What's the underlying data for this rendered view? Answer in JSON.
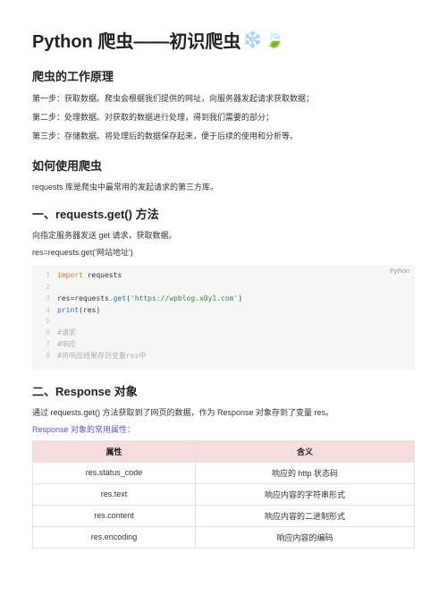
{
  "title": "Python 爬虫——初识爬虫",
  "emoji1": "❄️",
  "emoji2": "🍃",
  "sections": {
    "principle": {
      "heading": "爬虫的工作原理",
      "lines": [
        "第一步：获取数据。爬虫会根据我们提供的网址，向服务器发起请求获取数据；",
        "第二步：处理数据。对获取的数据进行处理，得到我们需要的部分；",
        "第三步：存储数据。将处理后的数据保存起来，便于后续的使用和分析等。"
      ]
    },
    "howto": {
      "heading": "如何使用爬虫",
      "desc": "requests 库是爬虫中最常用的发起请求的第三方库。"
    },
    "get": {
      "heading": "一、requests.get() 方法",
      "desc": "向指定服务器发送 get 请求，获取数据。",
      "snippet": "res=requests.get('网站地址')"
    },
    "code": {
      "lang": "Python",
      "lines": [
        {
          "n": "1",
          "kw": "import",
          "rest": " requests"
        },
        {
          "n": "2",
          "blank": true
        },
        {
          "n": "3",
          "assign_l": "res",
          "assign_r_mod": "requests",
          "assign_r_fn": ".get",
          "str": "'https://wpblog.x0y1.com'"
        },
        {
          "n": "4",
          "fn": "print",
          "arg": "res"
        },
        {
          "n": "5",
          "blank": true
        },
        {
          "n": "6",
          "cm": "#请求"
        },
        {
          "n": "7",
          "cm": "#响应"
        },
        {
          "n": "8",
          "cm": "#将响应结果存到变量res中"
        }
      ]
    },
    "response": {
      "heading": "二、Response 对象",
      "desc": "通过 requests.get() 方法获取到了网页的数据，作为 Response 对象存到了变量 res。",
      "link": "Response 对象的常用属性：",
      "table": {
        "headers": [
          "属性",
          "含义"
        ],
        "rows": [
          [
            "res.status_code",
            "响应的 http 状态码"
          ],
          [
            "res.text",
            "响应内容的字符串形式"
          ],
          [
            "res.content",
            "响应内容的二进制形式"
          ],
          [
            "res.encoding",
            "响应内容的编码"
          ]
        ]
      }
    }
  }
}
